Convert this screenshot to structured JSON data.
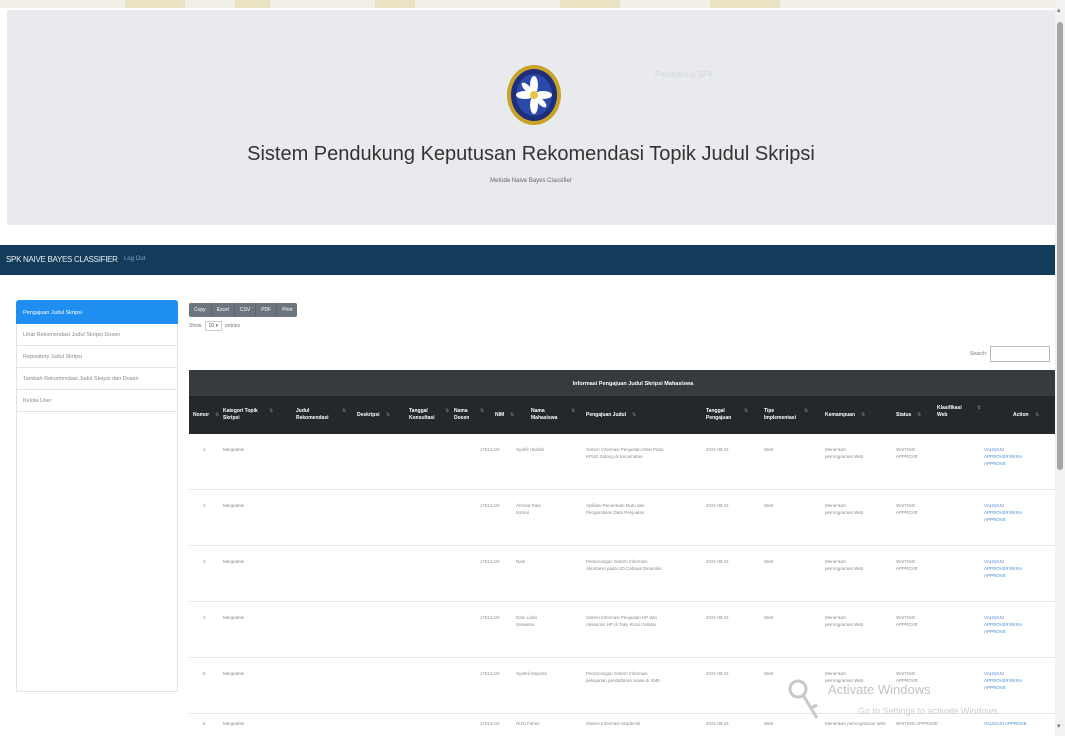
{
  "header": {
    "title": "Sistem Pendukung Keputusan Rekomendasi Topik Judul Skripsi",
    "subtitle": "Metode Naive Bayes Classifier",
    "ghost_text": "Pendukung SPK"
  },
  "navbar": {
    "brand": "SPK NAIVE BAYES CLASSIFIER",
    "logout": "Log Out"
  },
  "sidebar": {
    "items": [
      {
        "label": "Pengajuan Judul Skripsi"
      },
      {
        "label": "Lihat Rekomendasi Judul Skripsi Dosen"
      },
      {
        "label": "Repository Judul Skripsi"
      },
      {
        "label": "Tambah Rekomendasi Judul Skripsi dan Dosen"
      },
      {
        "label": "Kelola User"
      }
    ]
  },
  "export_buttons": [
    "Copy",
    "Excel",
    "CSV",
    "PDF",
    "Print"
  ],
  "show_entries": {
    "prefix": "Show",
    "value": "10",
    "suffix": "entries"
  },
  "search": {
    "label": "Search:",
    "value": ""
  },
  "table": {
    "title": "Informasi Pengajuan Judul Skripsi Mahasiswa",
    "columns": [
      "Nomor",
      "Kategori Topik Skripsi",
      "Judul Rekomendasi",
      "Deskripsi",
      "Tanggal Konsultasi",
      "Nama Dosen",
      "NIM",
      "Nama Mahasiswa",
      "Pengajuan Judul",
      "Tanggal Pengajuan",
      "Tipe Implementasi",
      "Kemampuan",
      "Status",
      "Klasifikasi Web",
      "Action"
    ],
    "rows": [
      {
        "no": "1",
        "kategori": "Mergeable",
        "nim": "1701X.0X",
        "nama": "Syafril Ulubah",
        "judul": "Sistem Informasi Penjualan Obat Pada KPUD Sidang di Kecamatan",
        "tanggal": "2021-08-21",
        "tipe": "Web",
        "kemampuan": "Menenkan pemrograman Web",
        "status": "WAITING APPROVE",
        "action": "VALIDASI APPROVE/FINISH APPROVE"
      },
      {
        "no": "2",
        "kategori": "Mergeable",
        "nim": "1701X.0X",
        "nama": "Ahmad Ratu Kamai",
        "judul": "Aplikasi Penentuan Mutu dan Pengambilan Data Penjualan",
        "tanggal": "2021-08-21",
        "tipe": "Web",
        "kemampuan": "Menenkan pemrograman Web",
        "status": "WAITING APPROVE",
        "action": "VALIDASI APPROVE/FINISH APPROVE"
      },
      {
        "no": "3",
        "kategori": "Mergeable",
        "nim": "1701X.0X",
        "nama": "Rani",
        "judul": "Perancangan Sistem Informasi Akuntansi pada UD Cahaya Dinamika",
        "tanggal": "2021-08-21",
        "tipe": "Web",
        "kemampuan": "Menenkan pemrograman Web",
        "status": "WAITING APPROVE",
        "action": "VALIDASI APPROVE/FINISH APPROVE"
      },
      {
        "no": "4",
        "kategori": "Mergeable",
        "nim": "1701X.0X",
        "nama": "Dani Lubis Siswanto",
        "judul": "Sistem Informasi Penjualan HP dan Aksesoris HP di Toko Rizal Cellular",
        "tanggal": "2021-08-21",
        "tipe": "Web",
        "kemampuan": "Menenkan pemrograman Web",
        "status": "WAITING APPROVE",
        "action": "VALIDASI APPROVE/FINISH APPROVE"
      },
      {
        "no": "5",
        "kategori": "Mergeable",
        "nim": "1701X.0X",
        "nama": "Syahril Saputra",
        "judul": "Perancangan Sistem Informasi pelayanan pendaftaran siswa di SMK",
        "tanggal": "2021-08-21",
        "tipe": "Web",
        "kemampuan": "Menenkan pemrograman Web",
        "status": "WAITING APPROVE",
        "action": "VALIDASI APPROVE/FINISH APPROVE"
      },
      {
        "no": "6",
        "kategori": "Mergeable",
        "nim": "1701X.0X",
        "nama": "Rizki Fahmi",
        "judul": "Sistem Informasi Akademik",
        "tanggal": "2021-08-21",
        "tipe": "Web",
        "kemampuan": "Menenkan pemrograman Web",
        "status": "WAITING APPROVE",
        "action": "VALIDASI APPROVE"
      }
    ]
  },
  "watermark": {
    "line1": "Activate Windows",
    "line2": "Go to Settings to activate Windows."
  }
}
